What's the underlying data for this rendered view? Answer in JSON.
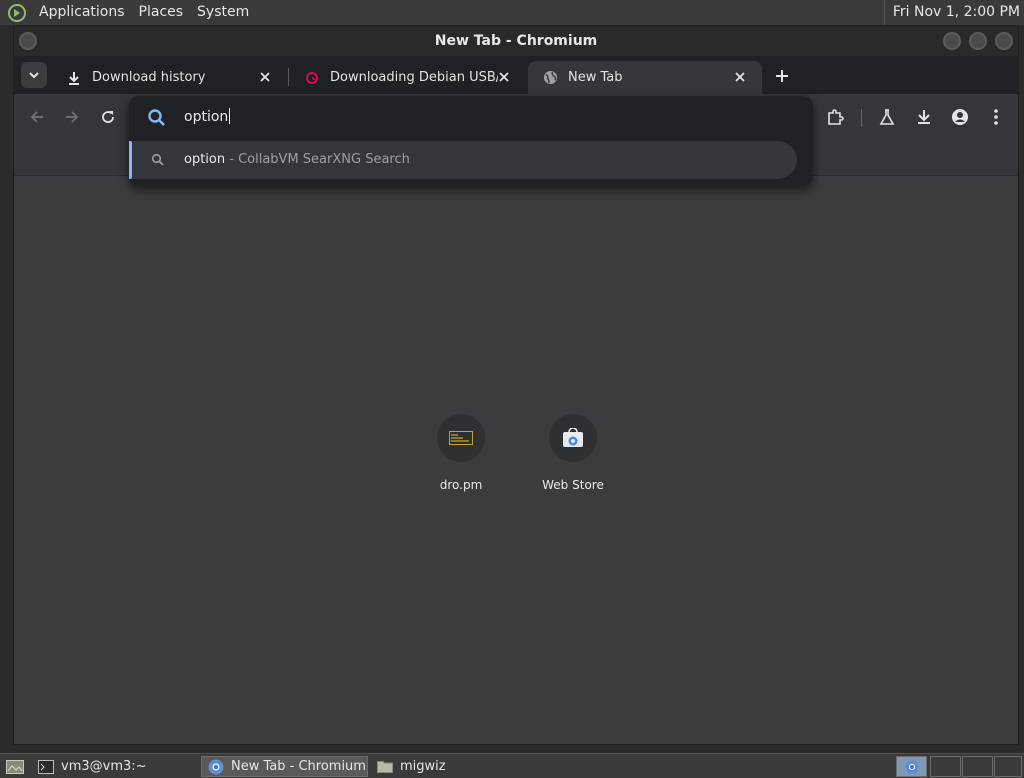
{
  "top_panel": {
    "menus": [
      "Applications",
      "Places",
      "System"
    ],
    "clock": "Fri Nov  1,  2:00 PM"
  },
  "window": {
    "title": "New Tab - Chromium"
  },
  "tabs": [
    {
      "label": "Download history",
      "icon": "download-icon",
      "active": false
    },
    {
      "label": "Downloading Debian USB/CD",
      "icon": "debian-swirl-icon",
      "active": false
    },
    {
      "label": "New Tab",
      "icon": "globe-icon",
      "active": true
    }
  ],
  "omnibox": {
    "input_value": "option",
    "suggestion": {
      "query": "option",
      "separator": " - ",
      "description": "CollabVM SearXNG Search"
    }
  },
  "shortcuts": [
    {
      "label": "dro.pm",
      "icon": "dro-pm-favicon"
    },
    {
      "label": "Web Store",
      "icon": "web-store-icon"
    }
  ],
  "taskbar": {
    "tasks": [
      {
        "label": "vm3@vm3:~",
        "icon": "terminal-icon",
        "active": false
      },
      {
        "label": "New Tab - Chromium",
        "icon": "chromium-icon",
        "active": true
      },
      {
        "label": "migwiz",
        "icon": "folder-icon",
        "active": false
      }
    ]
  },
  "colors": {
    "accent": "#8ab4f8",
    "toolbar": "#35363a",
    "tabstrip": "#202124",
    "page_bg": "#3c3c3f"
  }
}
